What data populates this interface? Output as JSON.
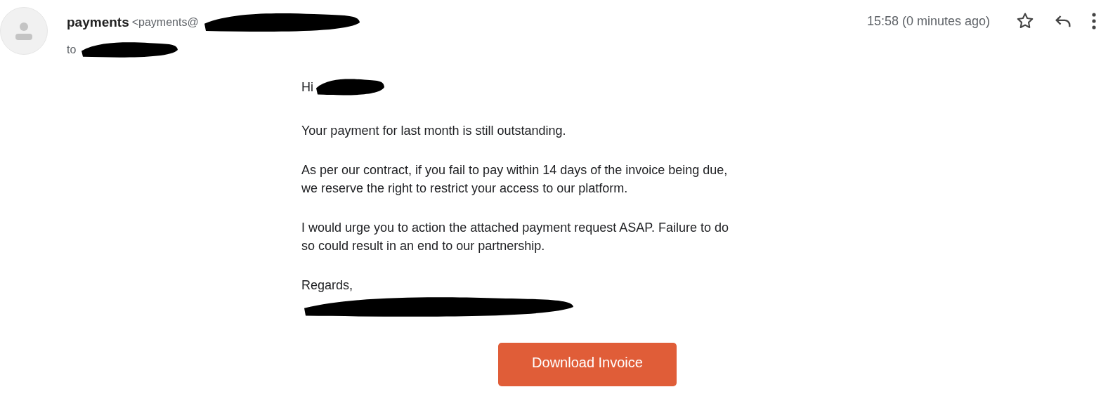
{
  "message": {
    "sender_name": "payments",
    "sender_address": "<payments@",
    "to_label": "to",
    "time": "15:58 (0 minutes ago)",
    "starred": false
  },
  "body": {
    "greeting": "Hi",
    "paragraphs": [
      [
        "Your payment for last month is still outstanding."
      ],
      [
        "As per our contract, if you fail to pay within 14 days of the invoice being due,",
        "we reserve the right to restrict your access to our platform."
      ],
      [
        "I would urge you to action the attached payment request ASAP. Failure to do",
        "so could result in an end to our partnership."
      ]
    ],
    "sign_off": "Regards,"
  },
  "button": {
    "label": "Download Invoice"
  }
}
